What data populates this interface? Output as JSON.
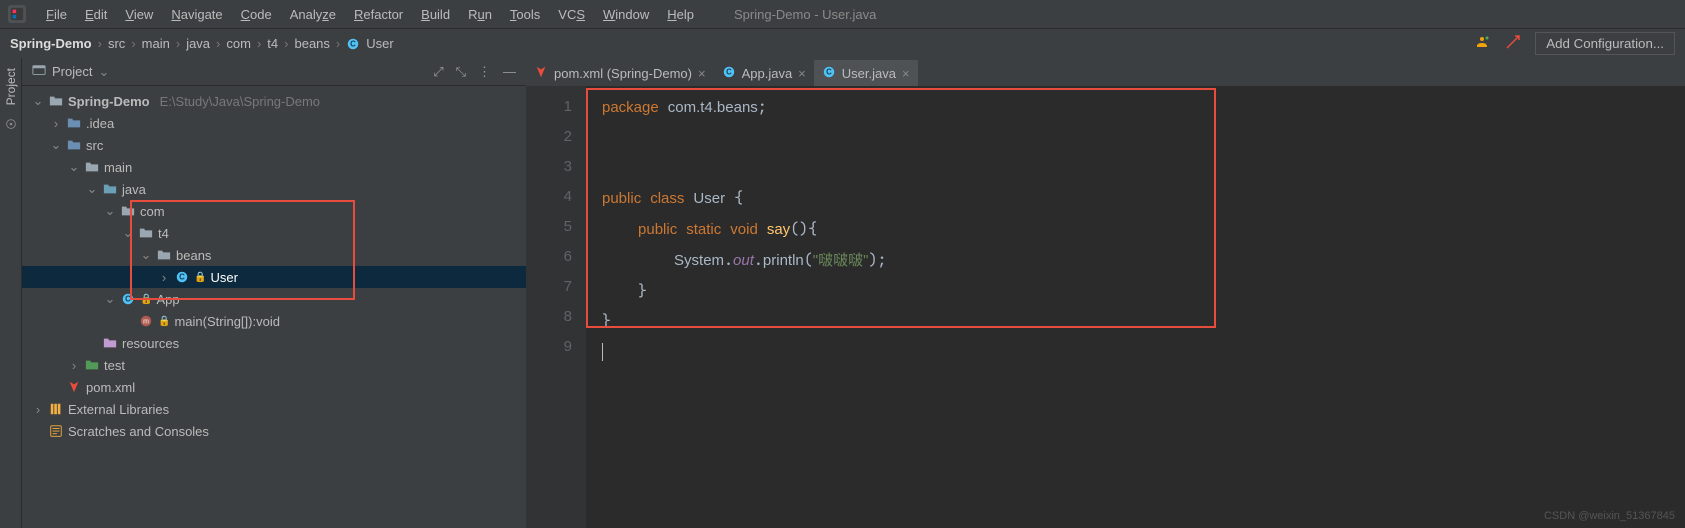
{
  "menu": {
    "items": [
      "File",
      "Edit",
      "View",
      "Navigate",
      "Code",
      "Analyze",
      "Refactor",
      "Build",
      "Run",
      "Tools",
      "VCS",
      "Window",
      "Help"
    ],
    "title": "Spring-Demo - User.java"
  },
  "breadcrumb": {
    "segs": [
      "Spring-Demo",
      "src",
      "main",
      "java",
      "com",
      "t4",
      "beans",
      "User"
    ]
  },
  "toolbar_right": {
    "add_config": "Add Configuration..."
  },
  "sidebar": {
    "header": "Project",
    "root_name": "Spring-Demo",
    "root_path": "E:\\Study\\Java\\Spring-Demo",
    "idea": ".idea",
    "src": "src",
    "main_f": "main",
    "java_f": "java",
    "com": "com",
    "t4": "t4",
    "beans": "beans",
    "user": "User",
    "app": "App",
    "app_method": "main(String[]):void",
    "resources": "resources",
    "test": "test",
    "pom": "pom.xml",
    "ext": "External Libraries",
    "scratch": "Scratches and Consoles"
  },
  "tabs": [
    {
      "label": "pom.xml (Spring-Demo)",
      "icon": "mvn",
      "active": false
    },
    {
      "label": "App.java",
      "icon": "class",
      "active": false
    },
    {
      "label": "User.java",
      "icon": "class",
      "active": true
    }
  ],
  "code": {
    "lines": 9,
    "package_kw": "package",
    "package_name": "com.t4.beans",
    "public": "public",
    "class": "class",
    "classname": "User",
    "static": "static",
    "void": "void",
    "method": "say",
    "system": "System",
    "out": "out",
    "println": "println",
    "string": "\"啵啵啵\""
  },
  "watermark": "CSDN @weixin_51367845"
}
